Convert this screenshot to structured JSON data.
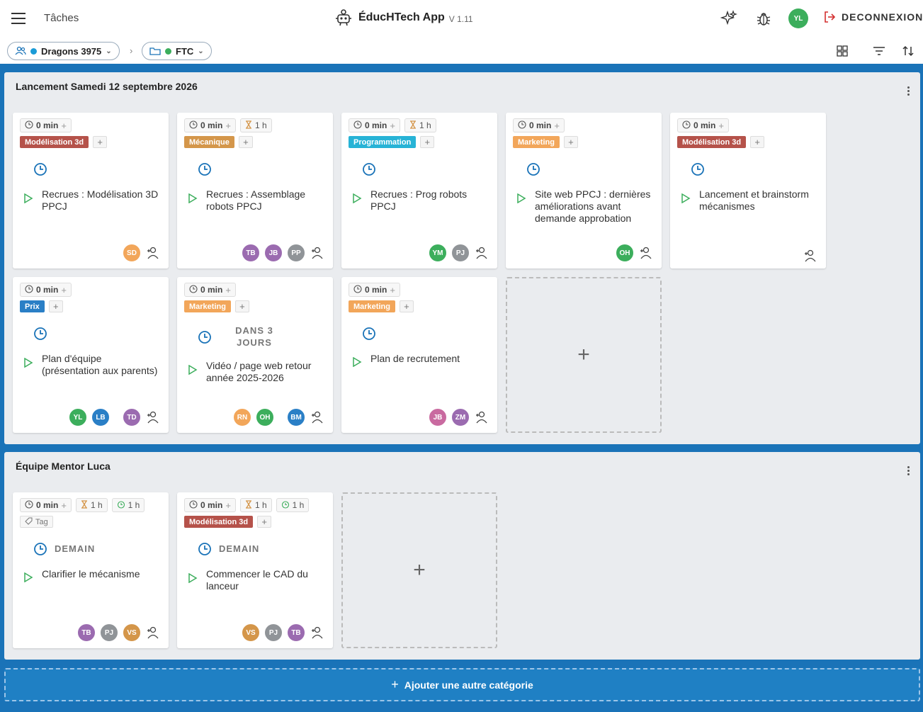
{
  "header": {
    "page_title": "Tâches",
    "app_name": "ÉducHTech App",
    "version": "V 1.11",
    "user_initials": "YL",
    "logout_label": "DECONNEXION"
  },
  "breadcrumb": {
    "team": "Dragons 3975",
    "team_dot_color": "#1a9bd7",
    "program": "FTC",
    "program_dot_color": "#3cae5c"
  },
  "colors": {
    "modelisation": "#b5524a",
    "mecanique": "#d4964a",
    "programmation": "#27b3d6",
    "marketing": "#f2a65a",
    "prix": "#2a7fc6"
  },
  "categories": [
    {
      "title": "Lancement Samedi 12 septembre 2026",
      "cards": [
        {
          "time": "0 min",
          "duration": "",
          "tag": "Modélisation 3d",
          "tag_color": "#b5524a",
          "due": "",
          "text": [
            "Recrues : Modélisation 3D",
            "PPCJ"
          ],
          "assignees": [
            {
              "i": "SD",
              "c": "#f2a65a"
            }
          ]
        },
        {
          "time": "0 min",
          "duration": "1 h",
          "tag": "Mécanique",
          "tag_color": "#d4964a",
          "due": "",
          "text": [
            "Recrues : Assemblage",
            "robots PPCJ"
          ],
          "assignees": [
            {
              "i": "TB",
              "c": "#9b6bb0"
            },
            {
              "i": "JB",
              "c": "#9b6bb0"
            },
            {
              "i": "PP",
              "c": "#909498"
            }
          ]
        },
        {
          "time": "0 min",
          "duration": "1 h",
          "tag": "Programmation",
          "tag_color": "#27b3d6",
          "due": "",
          "text": [
            "Recrues : Prog robots",
            "PPCJ"
          ],
          "assignees": [
            {
              "i": "YM",
              "c": "#3cae5c"
            },
            {
              "i": "PJ",
              "c": "#909498"
            }
          ]
        },
        {
          "time": "0 min",
          "duration": "",
          "tag": "Marketing",
          "tag_color": "#f2a65a",
          "due": "",
          "text": [
            "Site web PPCJ : dernières",
            "améliorations avant",
            "demande approbation"
          ],
          "assignees": [
            {
              "i": "OH",
              "c": "#3cae5c"
            }
          ]
        },
        {
          "time": "0 min",
          "duration": "",
          "tag": "Modélisation 3d",
          "tag_color": "#b5524a",
          "due": "",
          "text": [
            "Lancement et brainstorm",
            "mécanismes"
          ],
          "assignees": []
        },
        {
          "time": "0 min",
          "duration": "",
          "tag": "Prix",
          "tag_color": "#2a7fc6",
          "due": "",
          "text": [
            "Plan d'équipe",
            "(présentation aux parents)"
          ],
          "assignees": [
            {
              "i": "YL",
              "c": "#3cae5c"
            },
            {
              "i": "LB",
              "c": "#2a7fc6"
            },
            {
              "i": "TD",
              "c": "#9b6bb0"
            }
          ]
        },
        {
          "time": "0 min",
          "duration": "",
          "tag": "Marketing",
          "tag_color": "#f2a65a",
          "due": "DANS 3 JOURS",
          "text": [
            "Vidéo / page web retour",
            "année 2025-2026"
          ],
          "assignees": [
            {
              "i": "RN",
              "c": "#f2a65a"
            },
            {
              "i": "OH",
              "c": "#3cae5c"
            },
            {
              "i": "BM",
              "c": "#2a7fc6"
            }
          ]
        },
        {
          "time": "0 min",
          "duration": "",
          "tag": "Marketing",
          "tag_color": "#f2a65a",
          "due": "",
          "text": [
            "Plan de recrutement"
          ],
          "assignees": [
            {
              "i": "JB",
              "c": "#c96aa0"
            },
            {
              "i": "ZM",
              "c": "#9b6bb0"
            }
          ]
        }
      ]
    },
    {
      "title": "Équipe Mentor Luca",
      "cards": [
        {
          "time": "0 min",
          "duration": "1 h",
          "timer": "1 h",
          "tag": "",
          "tag_placeholder": "Tag",
          "due": "DEMAIN",
          "text": [
            "Clarifier le mécanisme"
          ],
          "assignees": [
            {
              "i": "TB",
              "c": "#9b6bb0"
            },
            {
              "i": "PJ",
              "c": "#909498"
            },
            {
              "i": "VS",
              "c": "#d4964a"
            }
          ]
        },
        {
          "time": "0 min",
          "duration": "1 h",
          "timer": "1 h",
          "tag": "Modélisation 3d",
          "tag_color": "#b5524a",
          "due": "DEMAIN",
          "text": [
            "Commencer le CAD du",
            "lanceur"
          ],
          "assignees": [
            {
              "i": "VS",
              "c": "#d4964a"
            },
            {
              "i": "PJ",
              "c": "#909498"
            },
            {
              "i": "TB",
              "c": "#9b6bb0"
            }
          ]
        }
      ]
    }
  ],
  "add_category_label": "Ajouter une autre catégorie"
}
